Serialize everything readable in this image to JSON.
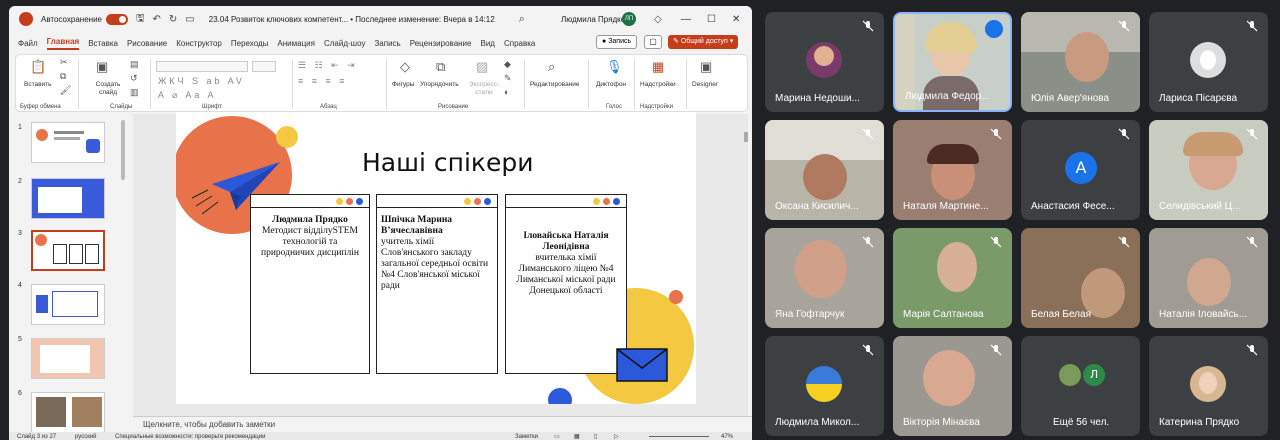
{
  "ppt": {
    "autosave_label": "Автосохранение",
    "doc_title": "23.04 Розвиток ключових компетент... • Последнее изменение: Вчера в 14:12",
    "user_name": "Людмила Прядко",
    "user_initials": "ЛП",
    "menu": [
      "Файл",
      "Главная",
      "Вставка",
      "Рисование",
      "Конструктор",
      "Переходы",
      "Анимация",
      "Слайд-шоу",
      "Запись",
      "Рецензирование",
      "Вид",
      "Справка"
    ],
    "active_menu": "Главная",
    "record_label": "Запись",
    "share_label": "Общий доступ",
    "ribbon": {
      "paste": "Вставить",
      "create_slide": "Создать слайд",
      "shapes": "Фигуры",
      "arrange": "Упорядочить",
      "quick_styles": "Экспресс-стили",
      "editing": "Редактирование",
      "dictate": "Диктофон",
      "addins": "Надстройки",
      "designer": "Designer",
      "groups": {
        "clipboard": "Буфер обмена",
        "slides": "Слайды",
        "font": "Шрифт",
        "paragraph": "Абзац",
        "drawing": "Рисование",
        "voice": "Голос",
        "addins": "Надстройки"
      }
    },
    "thumbnails": [
      "1",
      "2",
      "3",
      "4",
      "5",
      "6"
    ],
    "selected_thumb": "3",
    "slide": {
      "title": "Наші спікери",
      "speaker1": {
        "name": "Людмила Прядко",
        "desc": "Методист відділуSTEM технологій та природничих дисциплін"
      },
      "speaker2": {
        "name": "Шпічка Марина В’ячеславівна",
        "desc": "учитель хімії Слов'янського закладу загальної середньої освіти №4 Слов'янської міської ради"
      },
      "speaker3": {
        "name": "Іловайська Наталія Леонідівна",
        "desc": "вчителька хімії Лиманського ліцею №4 Лиманської міської ради Донецької області"
      }
    },
    "notes_placeholder": "Щелкните, чтобы добавить заметки",
    "status": {
      "slide_num": "Слайд 3 из 27",
      "lang": "русский",
      "accessibility": "Специальные возможности: проверьте рекомендации",
      "notes": "Заметки",
      "zoom": "47%"
    }
  },
  "meet": {
    "participants": [
      "Марина Недоши...",
      "Людмила Федор...",
      "Юлія Авер'янова",
      "Лариса Пісарєва",
      "Оксана Кисилич...",
      "Наталя Мартине...",
      "Анастасия Фесе...",
      "Селидівський Ц...",
      "Яна Гофтарчук",
      "Марія Салтанова",
      "Белая Белая",
      "Наталія Іловайсь...",
      "Людмила Микол...",
      "Вікторія Мінаєва",
      "Ещё 56 чел.",
      "Катерина Прядко"
    ],
    "anastasia_initial": "А",
    "more_initial": "Л"
  },
  "colors": {
    "ppt_accent": "#c43e1c",
    "meet_bg": "#202124",
    "tile_bg": "#3c4043",
    "speaking": "#1a73e8"
  }
}
